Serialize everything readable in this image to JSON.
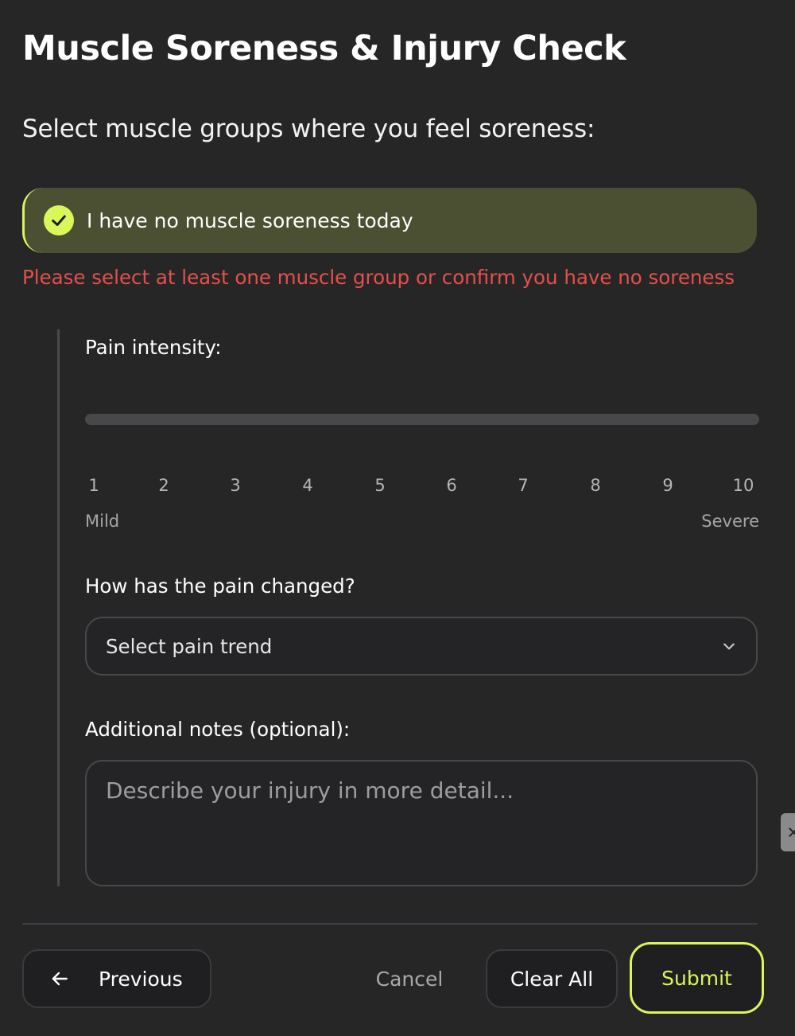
{
  "header": {
    "title": "Muscle Soreness & Injury Check"
  },
  "muscle_selection": {
    "prompt": "Select muscle groups where you feel soreness:",
    "no_soreness_option": {
      "label": "I have no muscle soreness today",
      "checked": true
    },
    "error_message": "Please select at least one muscle group or confirm you have no soreness"
  },
  "pain_intensity": {
    "label": "Pain intensity:",
    "scale": [
      "1",
      "2",
      "3",
      "4",
      "5",
      "6",
      "7",
      "8",
      "9",
      "10"
    ],
    "min_label": "Mild",
    "max_label": "Severe"
  },
  "pain_trend": {
    "label": "How has the pain changed?",
    "selected_value": "Select pain trend"
  },
  "notes": {
    "label": "Additional notes (optional):",
    "placeholder": "Describe your injury in more detail..."
  },
  "footer": {
    "previous_label": "Previous",
    "cancel_label": "Cancel",
    "clear_label": "Clear All",
    "submit_label": "Submit"
  },
  "colors": {
    "accent": "#d9f65a",
    "error": "#e5504a",
    "background": "#262627",
    "selected_option_bg": "#4a5031"
  },
  "icons": {
    "check": "check-circle-icon",
    "dropdown": "chevron-down-icon",
    "previous": "arrow-left-icon",
    "side_handle": "close-icon"
  }
}
